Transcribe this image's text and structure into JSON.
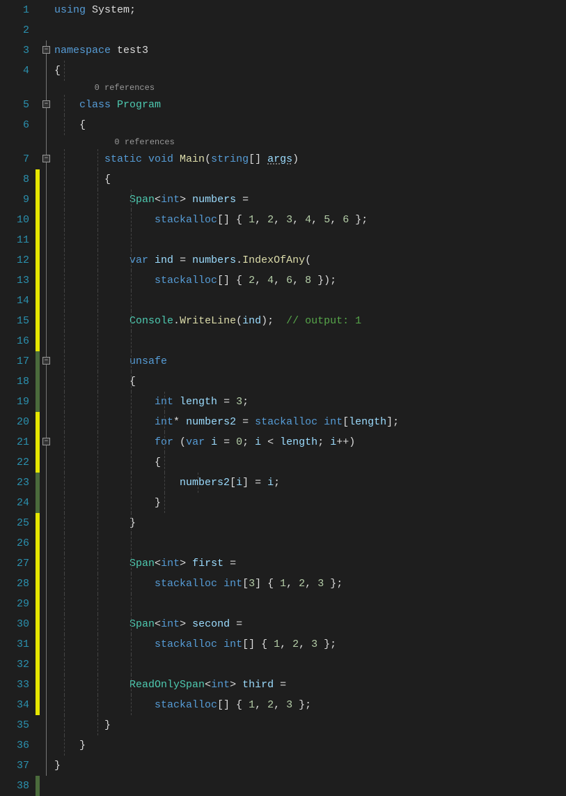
{
  "codelens": {
    "class": "0 references",
    "method": "0 references"
  },
  "lines": {
    "1": [
      {
        "t": "using ",
        "c": "kw"
      },
      {
        "t": "System",
        "c": "ident"
      },
      {
        "t": ";",
        "c": "punct"
      }
    ],
    "2": [],
    "3": [
      {
        "t": "namespace ",
        "c": "kw"
      },
      {
        "t": "test3",
        "c": "ident"
      }
    ],
    "4": [
      {
        "t": "{",
        "c": "punct"
      }
    ],
    "5": [
      {
        "t": "    ",
        "c": ""
      },
      {
        "t": "class ",
        "c": "kw"
      },
      {
        "t": "Program",
        "c": "type"
      }
    ],
    "6": [
      {
        "t": "    {",
        "c": "punct"
      }
    ],
    "7": [
      {
        "t": "        ",
        "c": ""
      },
      {
        "t": "static ",
        "c": "kw"
      },
      {
        "t": "void ",
        "c": "kw"
      },
      {
        "t": "Main",
        "c": "method"
      },
      {
        "t": "(",
        "c": "punct"
      },
      {
        "t": "string",
        "c": "kw"
      },
      {
        "t": "[] ",
        "c": "punct"
      },
      {
        "t": "args",
        "c": "param underline"
      },
      {
        "t": ")",
        "c": "punct"
      }
    ],
    "8": [
      {
        "t": "        {",
        "c": "punct"
      }
    ],
    "9": [
      {
        "t": "            ",
        "c": ""
      },
      {
        "t": "Span",
        "c": "type"
      },
      {
        "t": "<",
        "c": "punct"
      },
      {
        "t": "int",
        "c": "kw"
      },
      {
        "t": "> ",
        "c": "punct"
      },
      {
        "t": "numbers ",
        "c": "local"
      },
      {
        "t": "= ",
        "c": "op"
      }
    ],
    "10": [
      {
        "t": "                ",
        "c": ""
      },
      {
        "t": "stackalloc",
        "c": "kw"
      },
      {
        "t": "[] { ",
        "c": "punct"
      },
      {
        "t": "1",
        "c": "num"
      },
      {
        "t": ", ",
        "c": "punct"
      },
      {
        "t": "2",
        "c": "num"
      },
      {
        "t": ", ",
        "c": "punct"
      },
      {
        "t": "3",
        "c": "num"
      },
      {
        "t": ", ",
        "c": "punct"
      },
      {
        "t": "4",
        "c": "num"
      },
      {
        "t": ", ",
        "c": "punct"
      },
      {
        "t": "5",
        "c": "num"
      },
      {
        "t": ", ",
        "c": "punct"
      },
      {
        "t": "6",
        "c": "num"
      },
      {
        "t": " };",
        "c": "punct"
      }
    ],
    "11": [],
    "12": [
      {
        "t": "            ",
        "c": ""
      },
      {
        "t": "var ",
        "c": "kw"
      },
      {
        "t": "ind ",
        "c": "local"
      },
      {
        "t": "= ",
        "c": "op"
      },
      {
        "t": "numbers",
        "c": "local"
      },
      {
        "t": ".",
        "c": "punct"
      },
      {
        "t": "IndexOfAny",
        "c": "method"
      },
      {
        "t": "(",
        "c": "punct"
      }
    ],
    "13": [
      {
        "t": "                ",
        "c": ""
      },
      {
        "t": "stackalloc",
        "c": "kw"
      },
      {
        "t": "[] { ",
        "c": "punct"
      },
      {
        "t": "2",
        "c": "num"
      },
      {
        "t": ", ",
        "c": "punct"
      },
      {
        "t": "4",
        "c": "num"
      },
      {
        "t": ", ",
        "c": "punct"
      },
      {
        "t": "6",
        "c": "num"
      },
      {
        "t": ", ",
        "c": "punct"
      },
      {
        "t": "8",
        "c": "num"
      },
      {
        "t": " });",
        "c": "punct"
      }
    ],
    "14": [],
    "15": [
      {
        "t": "            ",
        "c": ""
      },
      {
        "t": "Console",
        "c": "type"
      },
      {
        "t": ".",
        "c": "punct"
      },
      {
        "t": "WriteLine",
        "c": "method"
      },
      {
        "t": "(",
        "c": "punct"
      },
      {
        "t": "ind",
        "c": "local"
      },
      {
        "t": ");  ",
        "c": "punct"
      },
      {
        "t": "// output: 1",
        "c": "comment"
      }
    ],
    "16": [],
    "17": [
      {
        "t": "            ",
        "c": ""
      },
      {
        "t": "unsafe",
        "c": "kw"
      }
    ],
    "18": [
      {
        "t": "            {",
        "c": "punct"
      }
    ],
    "19": [
      {
        "t": "                ",
        "c": ""
      },
      {
        "t": "int ",
        "c": "kw"
      },
      {
        "t": "length ",
        "c": "local"
      },
      {
        "t": "= ",
        "c": "op"
      },
      {
        "t": "3",
        "c": "num"
      },
      {
        "t": ";",
        "c": "punct"
      }
    ],
    "20": [
      {
        "t": "                ",
        "c": ""
      },
      {
        "t": "int",
        "c": "kw"
      },
      {
        "t": "* ",
        "c": "punct"
      },
      {
        "t": "numbers2 ",
        "c": "local"
      },
      {
        "t": "= ",
        "c": "op"
      },
      {
        "t": "stackalloc ",
        "c": "kw"
      },
      {
        "t": "int",
        "c": "kw"
      },
      {
        "t": "[",
        "c": "punct"
      },
      {
        "t": "length",
        "c": "local"
      },
      {
        "t": "];",
        "c": "punct"
      }
    ],
    "21": [
      {
        "t": "                ",
        "c": ""
      },
      {
        "t": "for ",
        "c": "kw"
      },
      {
        "t": "(",
        "c": "punct"
      },
      {
        "t": "var ",
        "c": "kw"
      },
      {
        "t": "i ",
        "c": "local"
      },
      {
        "t": "= ",
        "c": "op"
      },
      {
        "t": "0",
        "c": "num"
      },
      {
        "t": "; ",
        "c": "punct"
      },
      {
        "t": "i ",
        "c": "local"
      },
      {
        "t": "< ",
        "c": "op"
      },
      {
        "t": "length",
        "c": "local"
      },
      {
        "t": "; ",
        "c": "punct"
      },
      {
        "t": "i",
        "c": "local"
      },
      {
        "t": "++)",
        "c": "punct"
      }
    ],
    "22": [
      {
        "t": "                {",
        "c": "punct"
      }
    ],
    "23": [
      {
        "t": "                    ",
        "c": ""
      },
      {
        "t": "numbers2",
        "c": "local"
      },
      {
        "t": "[",
        "c": "punct"
      },
      {
        "t": "i",
        "c": "local"
      },
      {
        "t": "] = ",
        "c": "punct"
      },
      {
        "t": "i",
        "c": "local"
      },
      {
        "t": ";",
        "c": "punct"
      }
    ],
    "24": [
      {
        "t": "                }",
        "c": "punct"
      }
    ],
    "25": [
      {
        "t": "            }",
        "c": "punct"
      }
    ],
    "26": [],
    "27": [
      {
        "t": "            ",
        "c": ""
      },
      {
        "t": "Span",
        "c": "type"
      },
      {
        "t": "<",
        "c": "punct"
      },
      {
        "t": "int",
        "c": "kw"
      },
      {
        "t": "> ",
        "c": "punct"
      },
      {
        "t": "first ",
        "c": "local"
      },
      {
        "t": "=",
        "c": "op"
      }
    ],
    "28": [
      {
        "t": "                ",
        "c": ""
      },
      {
        "t": "stackalloc ",
        "c": "kw"
      },
      {
        "t": "int",
        "c": "kw"
      },
      {
        "t": "[",
        "c": "punct"
      },
      {
        "t": "3",
        "c": "num"
      },
      {
        "t": "] { ",
        "c": "punct"
      },
      {
        "t": "1",
        "c": "num"
      },
      {
        "t": ", ",
        "c": "punct"
      },
      {
        "t": "2",
        "c": "num"
      },
      {
        "t": ", ",
        "c": "punct"
      },
      {
        "t": "3",
        "c": "num"
      },
      {
        "t": " };",
        "c": "punct"
      }
    ],
    "29": [],
    "30": [
      {
        "t": "            ",
        "c": ""
      },
      {
        "t": "Span",
        "c": "type"
      },
      {
        "t": "<",
        "c": "punct"
      },
      {
        "t": "int",
        "c": "kw"
      },
      {
        "t": "> ",
        "c": "punct"
      },
      {
        "t": "second ",
        "c": "local"
      },
      {
        "t": "=",
        "c": "op"
      }
    ],
    "31": [
      {
        "t": "                ",
        "c": ""
      },
      {
        "t": "stackalloc ",
        "c": "kw"
      },
      {
        "t": "int",
        "c": "kw"
      },
      {
        "t": "[] { ",
        "c": "punct"
      },
      {
        "t": "1",
        "c": "num"
      },
      {
        "t": ", ",
        "c": "punct"
      },
      {
        "t": "2",
        "c": "num"
      },
      {
        "t": ", ",
        "c": "punct"
      },
      {
        "t": "3",
        "c": "num"
      },
      {
        "t": " };",
        "c": "punct"
      }
    ],
    "32": [],
    "33": [
      {
        "t": "            ",
        "c": ""
      },
      {
        "t": "ReadOnlySpan",
        "c": "type"
      },
      {
        "t": "<",
        "c": "punct"
      },
      {
        "t": "int",
        "c": "kw"
      },
      {
        "t": "> ",
        "c": "punct"
      },
      {
        "t": "third ",
        "c": "local"
      },
      {
        "t": "=",
        "c": "op"
      }
    ],
    "34": [
      {
        "t": "                ",
        "c": ""
      },
      {
        "t": "stackalloc",
        "c": "kw"
      },
      {
        "t": "[] { ",
        "c": "punct"
      },
      {
        "t": "1",
        "c": "num"
      },
      {
        "t": ", ",
        "c": "punct"
      },
      {
        "t": "2",
        "c": "num"
      },
      {
        "t": ", ",
        "c": "punct"
      },
      {
        "t": "3",
        "c": "num"
      },
      {
        "t": " };",
        "c": "punct"
      }
    ],
    "35": [
      {
        "t": "        }",
        "c": "punct"
      }
    ],
    "36": [
      {
        "t": "    }",
        "c": "punct"
      }
    ],
    "37": [
      {
        "t": "}",
        "c": "punct"
      }
    ],
    "38": []
  },
  "lineNumbers": [
    "1",
    "2",
    "3",
    "4",
    "5",
    "6",
    "7",
    "8",
    "9",
    "10",
    "11",
    "12",
    "13",
    "14",
    "15",
    "16",
    "17",
    "18",
    "19",
    "20",
    "21",
    "22",
    "23",
    "24",
    "25",
    "26",
    "27",
    "28",
    "29",
    "30",
    "31",
    "32",
    "33",
    "34",
    "35",
    "36",
    "37",
    "38"
  ],
  "changeBars": {
    "8": "yellow",
    "9": "yellow",
    "10": "yellow",
    "11": "yellow",
    "12": "yellow",
    "13": "yellow",
    "14": "yellow",
    "15": "yellow",
    "16": "yellow",
    "17": "green",
    "18": "green",
    "19": "green",
    "20": "yellow",
    "21": "yellow",
    "22": "yellow",
    "23": "green",
    "24": "green",
    "25": "yellow",
    "26": "yellow",
    "27": "yellow",
    "28": "yellow",
    "29": "yellow",
    "30": "yellow",
    "31": "yellow",
    "32": "yellow",
    "33": "yellow",
    "34": "yellow",
    "38": "green"
  },
  "foldBoxes": {
    "3": true,
    "5": true,
    "7": true,
    "17": true,
    "21": true
  },
  "codelensBefore": {
    "5": "class",
    "7": "method"
  },
  "guideLevels": {
    "4": [
      0
    ],
    "5": [
      0
    ],
    "6": [
      0
    ],
    "7": [
      0,
      1
    ],
    "8": [
      0,
      1
    ],
    "9": [
      0,
      1,
      2
    ],
    "10": [
      0,
      1,
      2
    ],
    "11": [
      0,
      1,
      2
    ],
    "12": [
      0,
      1,
      2
    ],
    "13": [
      0,
      1,
      2
    ],
    "14": [
      0,
      1,
      2
    ],
    "15": [
      0,
      1,
      2
    ],
    "16": [
      0,
      1,
      2
    ],
    "17": [
      0,
      1,
      2
    ],
    "18": [
      0,
      1,
      2
    ],
    "19": [
      0,
      1,
      2,
      3
    ],
    "20": [
      0,
      1,
      2,
      3
    ],
    "21": [
      0,
      1,
      2,
      3
    ],
    "22": [
      0,
      1,
      2,
      3
    ],
    "23": [
      0,
      1,
      2,
      3,
      4
    ],
    "24": [
      0,
      1,
      2,
      3
    ],
    "25": [
      0,
      1,
      2
    ],
    "26": [
      0,
      1,
      2
    ],
    "27": [
      0,
      1,
      2
    ],
    "28": [
      0,
      1,
      2
    ],
    "29": [
      0,
      1,
      2
    ],
    "30": [
      0,
      1,
      2
    ],
    "31": [
      0,
      1,
      2
    ],
    "32": [
      0,
      1,
      2
    ],
    "33": [
      0,
      1,
      2
    ],
    "34": [
      0,
      1,
      2
    ],
    "35": [
      0,
      1
    ],
    "36": [
      0
    ],
    "37": []
  }
}
